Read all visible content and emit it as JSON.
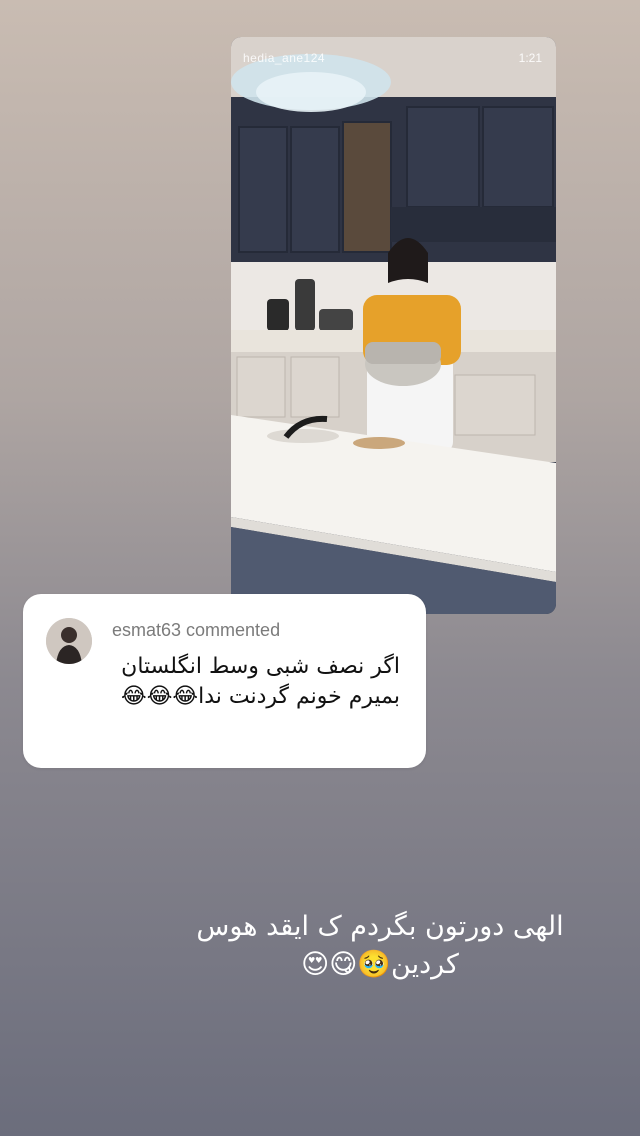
{
  "video": {
    "username": "hedia_ane124",
    "timestamp": "1:21"
  },
  "comment": {
    "username_line": "esmat63 commented",
    "text": "اگر نصف شبی وسط انگلستان بمیرم خونم گردنت ندا😂😂😂"
  },
  "caption": {
    "text": "الهی دورتون بگردم ک ایقد هوس کردین🥹😋😍"
  },
  "colors": {
    "card_bg": "#ffffff",
    "cabinet": "#2f3444",
    "counter": "#f2f0ec"
  }
}
